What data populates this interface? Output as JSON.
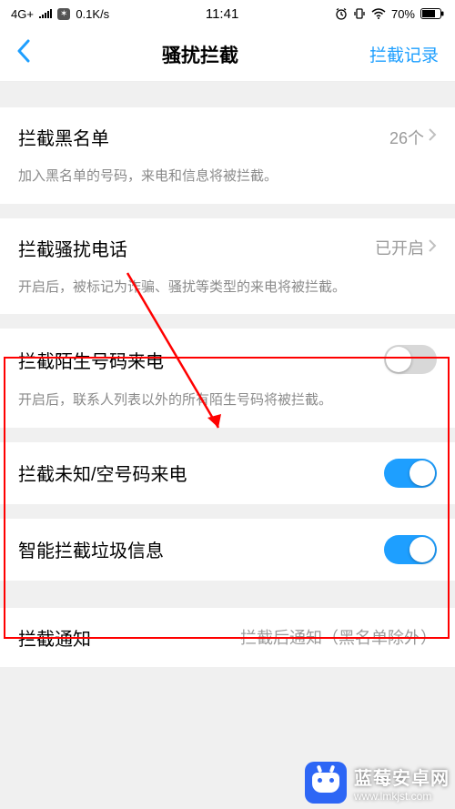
{
  "statusbar": {
    "network": "4G+",
    "speed": "0.1K/s",
    "time": "11:41",
    "battery_pct": "70%"
  },
  "navbar": {
    "title": "骚扰拦截",
    "action": "拦截记录"
  },
  "rows": {
    "blacklist": {
      "title": "拦截黑名单",
      "value": "26个",
      "desc": "加入黑名单的号码，来电和信息将被拦截。"
    },
    "spam_calls": {
      "title": "拦截骚扰电话",
      "value": "已开启",
      "desc": "开启后，被标记为诈骗、骚扰等类型的来电将被拦截。"
    },
    "stranger": {
      "title": "拦截陌生号码来电",
      "desc": "开启后，联系人列表以外的所有陌生号码将被拦截。"
    },
    "unknown": {
      "title": "拦截未知/空号码来电"
    },
    "smart_sms": {
      "title": "智能拦截垃圾信息"
    },
    "notify": {
      "title": "拦截通知",
      "value": "拦截后通知（黑名单除外）"
    }
  },
  "watermark": {
    "line1": "蓝莓安卓网",
    "line2": "www.lmkjst.com"
  }
}
